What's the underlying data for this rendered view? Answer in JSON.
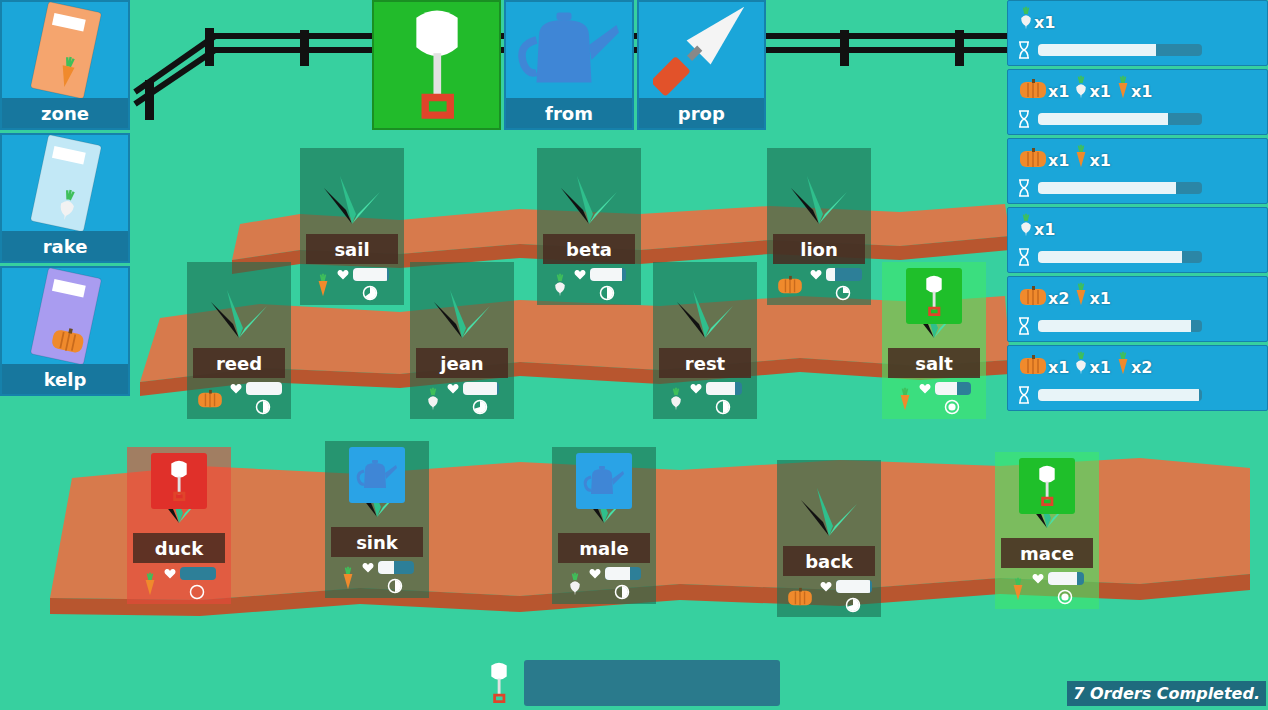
{
  "seed_packets": [
    {
      "label": "zone",
      "kind": "carrot",
      "color": "#f5a56e"
    },
    {
      "label": "rake",
      "kind": "turnip",
      "color": "#c2e8f6"
    },
    {
      "label": "kelp",
      "kind": "pumpkin",
      "color": "#a99cf0"
    }
  ],
  "tools": [
    {
      "kind": "shovel",
      "selected": true
    },
    {
      "label": "from",
      "kind": "watering-can",
      "selected": false
    },
    {
      "label": "prop",
      "kind": "trowel",
      "selected": false
    }
  ],
  "orders": [
    {
      "items": [
        {
          "kind": "turnip",
          "count": "x1"
        }
      ],
      "level": 0.72
    },
    {
      "items": [
        {
          "kind": "pumpkin",
          "count": "x1"
        },
        {
          "kind": "turnip",
          "count": "x1"
        },
        {
          "kind": "carrot",
          "count": "x1"
        }
      ],
      "level": 0.79
    },
    {
      "items": [
        {
          "kind": "pumpkin",
          "count": "x1"
        },
        {
          "kind": "carrot",
          "count": "x1"
        }
      ],
      "level": 0.84
    },
    {
      "items": [
        {
          "kind": "turnip",
          "count": "x1"
        }
      ],
      "level": 0.88
    },
    {
      "items": [
        {
          "kind": "pumpkin",
          "count": "x2"
        },
        {
          "kind": "carrot",
          "count": "x1"
        }
      ],
      "level": 0.93
    },
    {
      "items": [
        {
          "kind": "pumpkin",
          "count": "x1"
        },
        {
          "kind": "turnip",
          "count": "x1"
        },
        {
          "kind": "carrot",
          "count": "x2"
        }
      ],
      "level": 0.98
    }
  ],
  "plots": [
    {
      "name": "sail",
      "crop": "carrot",
      "health": 0.95,
      "growth": 0.65,
      "color": "#1a6e52",
      "action": null
    },
    {
      "name": "beta",
      "crop": "turnip",
      "health": 0.9,
      "growth": 0.5,
      "color": "#1a6e52",
      "action": null
    },
    {
      "name": "lion",
      "crop": "pumpkin",
      "health": 0.25,
      "growth": 0.25,
      "color": "#1a6e52",
      "action": null
    },
    {
      "name": "reed",
      "crop": "pumpkin",
      "health": 1,
      "growth": 0.5,
      "color": "#1a6e52",
      "action": null
    },
    {
      "name": "jean",
      "crop": "turnip",
      "health": 0.95,
      "growth": 0.7,
      "color": "#1a6e52",
      "action": null
    },
    {
      "name": "rest",
      "crop": "turnip",
      "health": 0.8,
      "growth": 0.5,
      "color": "#1a6e52",
      "action": null
    },
    {
      "name": "salt",
      "crop": "carrot",
      "health": 0.6,
      "growth": 1,
      "color": "#3ee86a",
      "action": {
        "kind": "shovel",
        "color": "#1fbf2a"
      }
    },
    {
      "name": "duck",
      "crop": "carrot",
      "health": 0,
      "growth": 0,
      "color": "#e8473a",
      "action": {
        "kind": "shovel",
        "color": "#e0302a"
      }
    },
    {
      "name": "sink",
      "crop": "carrot",
      "health": 0.45,
      "growth": 0.5,
      "color": "#1a6e52",
      "action": {
        "kind": "watering-can",
        "color": "#2aa3e6"
      }
    },
    {
      "name": "male",
      "crop": "turnip",
      "health": 0.7,
      "growth": 0.5,
      "color": "#1a6e52",
      "action": {
        "kind": "watering-can",
        "color": "#2aa3e6"
      }
    },
    {
      "name": "back",
      "crop": "pumpkin",
      "health": 0.95,
      "growth": 0.7,
      "color": "#1a6e52",
      "action": null
    },
    {
      "name": "mace",
      "crop": "carrot",
      "health": 0.8,
      "growth": 1,
      "color": "#3ee86a",
      "action": {
        "kind": "shovel",
        "color": "#1fbf2a"
      }
    }
  ],
  "command_bar": {
    "tool": "shovel"
  },
  "status": "7 Orders Completed."
}
